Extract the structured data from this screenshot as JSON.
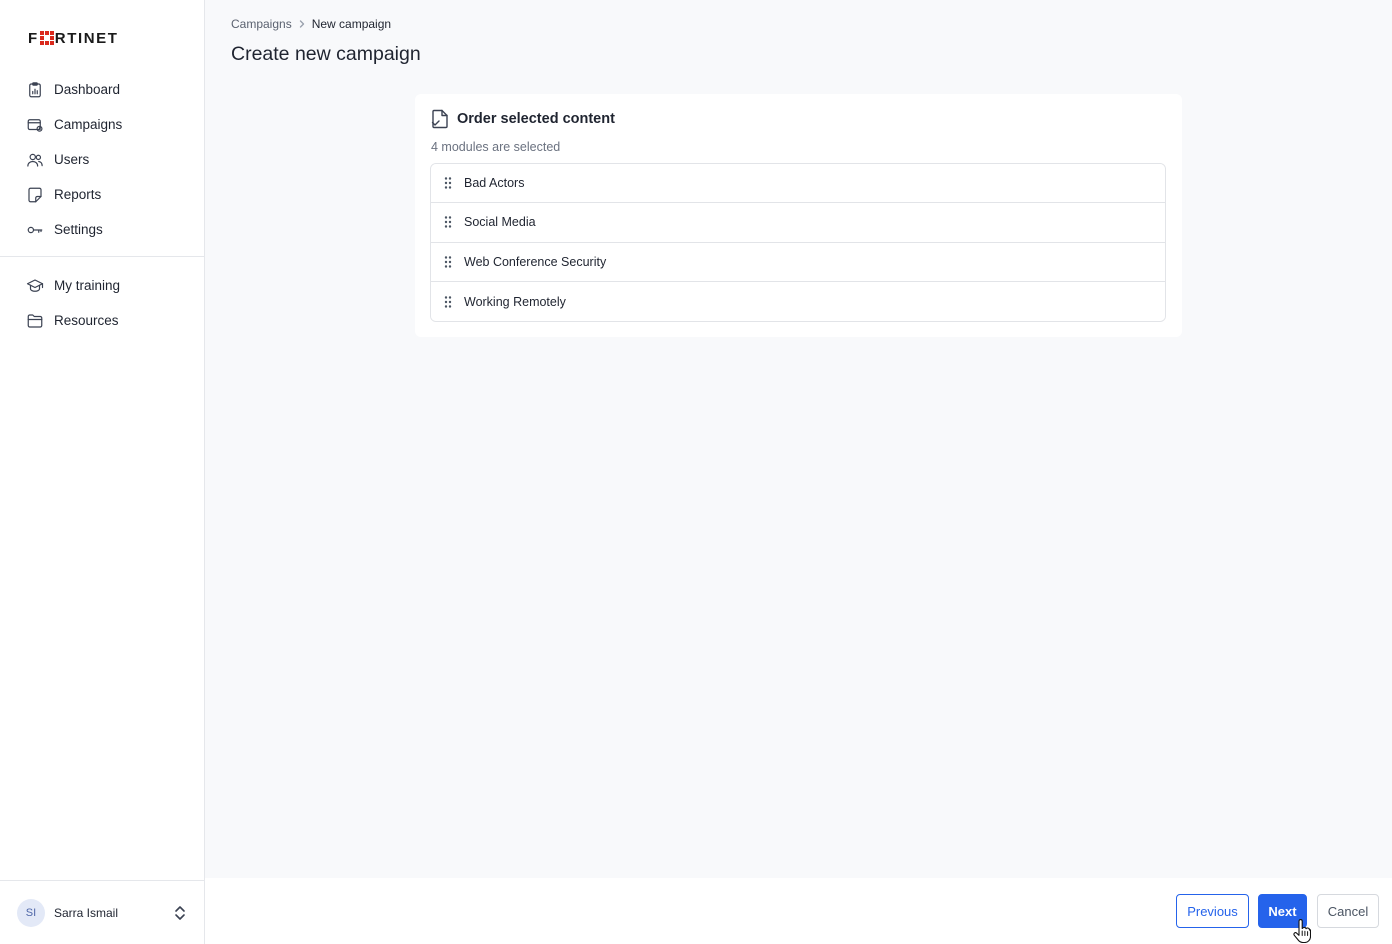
{
  "brand": {
    "logo_text_left": "F",
    "logo_text_right": "RTINET"
  },
  "sidebar": {
    "main_items": [
      {
        "label": "Dashboard",
        "icon": "clipboard-chart-icon"
      },
      {
        "label": "Campaigns",
        "icon": "campaign-card-icon"
      },
      {
        "label": "Users",
        "icon": "users-icon"
      },
      {
        "label": "Reports",
        "icon": "report-icon"
      },
      {
        "label": "Settings",
        "icon": "key-icon"
      }
    ],
    "secondary_items": [
      {
        "label": "My training",
        "icon": "graduation-cap-icon"
      },
      {
        "label": "Resources",
        "icon": "folder-icon"
      }
    ],
    "user": {
      "initials": "SI",
      "name": "Sarra Ismail"
    }
  },
  "breadcrumb": {
    "parent": "Campaigns",
    "current": "New campaign"
  },
  "page": {
    "title": "Create new campaign"
  },
  "card": {
    "title": "Order selected content",
    "subtitle": "4 modules are selected",
    "modules": [
      "Bad Actors",
      "Social Media",
      "Web Conference Security",
      "Working Remotely"
    ]
  },
  "footer": {
    "previous_label": "Previous",
    "next_label": "Next",
    "cancel_label": "Cancel"
  },
  "colors": {
    "primary": "#2563eb",
    "brand_red": "#da291c"
  }
}
